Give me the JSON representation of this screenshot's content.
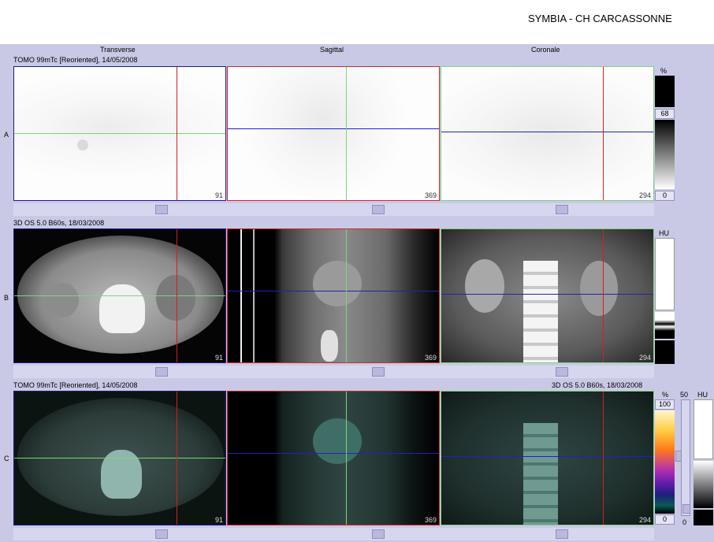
{
  "header": {
    "title": "SYMBIA - CH CARCASSONNE"
  },
  "views": {
    "transverse": "Transverse",
    "sagittal": "Sagittal",
    "coronal": "Coronale"
  },
  "rows": {
    "a": {
      "label": "A",
      "series": "TOMO 99mTc [Reoriented], 14/05/2008",
      "slices": [
        "91",
        "369",
        "294"
      ],
      "scale": {
        "unit": "%",
        "max": "68",
        "min": "0"
      }
    },
    "b": {
      "label": "B",
      "series": "3D  OS  5.0  B60s, 18/03/2008",
      "slices": [
        "91",
        "369",
        "294"
      ],
      "scale": {
        "unit": "HU"
      }
    },
    "c": {
      "label": "C",
      "series_left": "TOMO 99mTc [Reoriented], 14/05/2008",
      "series_right": "3D  OS  5.0  B60s, 18/03/2008",
      "slices": [
        "91",
        "369",
        "294"
      ],
      "scale": {
        "unit": "%",
        "max": "100",
        "min": "0",
        "blend": "50",
        "unit2": "HU",
        "blend_min": "0"
      }
    }
  },
  "colors": {
    "crosshair_h": "#2222bb",
    "crosshair_v": "#cc2222",
    "crosshair_green": "#7fd27f",
    "accent": "#c9c9e6"
  }
}
